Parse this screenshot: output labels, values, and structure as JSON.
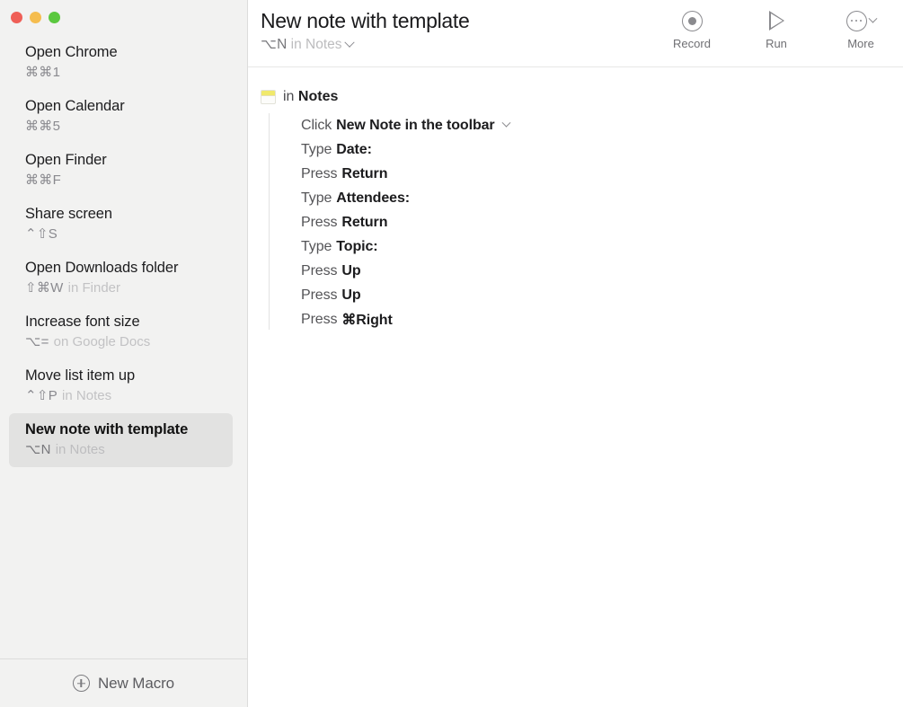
{
  "window": {
    "traffic_lights": [
      {
        "name": "close",
        "color": "#ef5f57"
      },
      {
        "name": "minimize",
        "color": "#f5bd4f"
      },
      {
        "name": "zoom",
        "color": "#5bc83f"
      }
    ]
  },
  "sidebar": {
    "macros": [
      {
        "name": "Open Chrome",
        "keys": "⌘⌘1",
        "scope": ""
      },
      {
        "name": "Open Calendar",
        "keys": "⌘⌘5",
        "scope": ""
      },
      {
        "name": "Open Finder",
        "keys": "⌘⌘F",
        "scope": ""
      },
      {
        "name": "Share screen",
        "keys": "⌃⇧S",
        "scope": ""
      },
      {
        "name": "Open Downloads folder",
        "keys": "⇧⌘W",
        "scope": "in Finder"
      },
      {
        "name": "Increase font size",
        "keys": "⌥=",
        "scope": "on Google Docs"
      },
      {
        "name": "Move list item up",
        "keys": "⌃⇧P",
        "scope": "in Notes"
      },
      {
        "name": "New note with template",
        "keys": "⌥N",
        "scope": "in Notes",
        "selected": true
      }
    ],
    "footer": {
      "new_macro_label": "New Macro",
      "new_macro_icon": "plus-circle-icon"
    }
  },
  "header": {
    "title": "New note with template",
    "subtitle_keys": "⌥N",
    "subtitle_scope": "in Notes",
    "subtitle_chevron": "chevron-down-icon",
    "toolbar": [
      {
        "label": "Record",
        "icon": "record-icon"
      },
      {
        "label": "Run",
        "icon": "play-icon"
      },
      {
        "label": "More",
        "icon": "ellipsis-circle-icon"
      }
    ]
  },
  "editor": {
    "group": {
      "icon": "notes-app-icon",
      "prefix": "in",
      "app": "Notes"
    },
    "steps": [
      {
        "verb": "Click",
        "arg": "New Note in the toolbar",
        "chevron": true
      },
      {
        "verb": "Type",
        "arg": "Date:"
      },
      {
        "verb": "Press",
        "arg": "Return"
      },
      {
        "verb": "Type",
        "arg": "Attendees:"
      },
      {
        "verb": "Press",
        "arg": "Return"
      },
      {
        "verb": "Type",
        "arg": "Topic:"
      },
      {
        "verb": "Press",
        "arg": "Up"
      },
      {
        "verb": "Press",
        "arg": "Up"
      },
      {
        "verb": "Press",
        "arg": "⌘Right"
      }
    ]
  },
  "colors": {
    "sidebar_bg": "#f2f2f1",
    "selection_bg": "#e2e2e1",
    "main_bg": "#ffffff",
    "divider": "#e7e7e6",
    "text_primary": "#1d1d1f",
    "text_secondary": "#8e8e93",
    "text_muted": "#c2c2c4",
    "notes_yellow": "#f0e96b"
  }
}
